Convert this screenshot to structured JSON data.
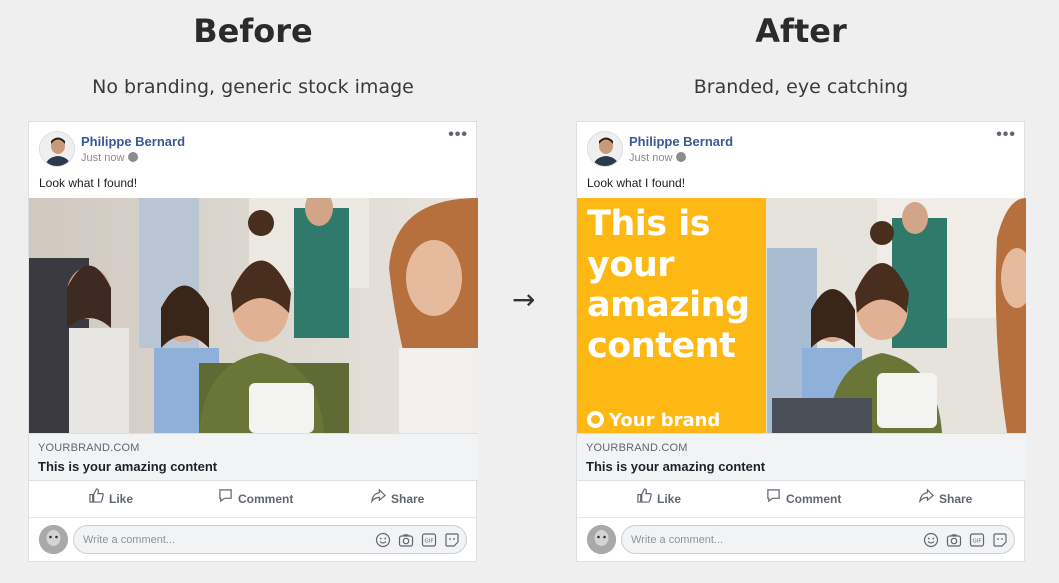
{
  "before": {
    "heading": "Before",
    "subtitle": "No branding, generic stock image"
  },
  "after": {
    "heading": "After",
    "subtitle": "Branded, eye catching",
    "overlay_text": "This is your amazing content",
    "brand_label": "Your brand",
    "brand_color": "#fdb813"
  },
  "arrow": "→",
  "post": {
    "author": "Philippe Bernard",
    "time": "Just now",
    "text": "Look what I found!",
    "more_icon": "•••",
    "link_domain": "YOURBRAND.COM",
    "link_title": "This is your amazing content",
    "actions": {
      "like": "Like",
      "comment": "Comment",
      "share": "Share"
    },
    "comment_placeholder": "Write a comment..."
  },
  "colors": {
    "name_link": "#385898",
    "background": "#efefef"
  }
}
